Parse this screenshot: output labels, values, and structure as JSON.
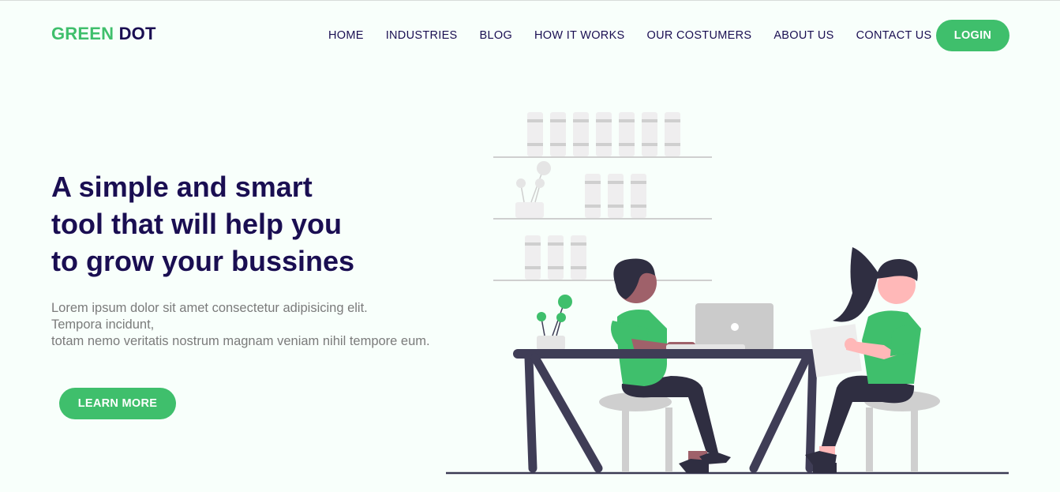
{
  "brand": {
    "part1": "GREEN",
    "part2": "DOT",
    "accent_color": "#3fbf6c",
    "dark_color": "#1a0e52"
  },
  "nav": {
    "items": [
      {
        "label": "HOME"
      },
      {
        "label": "INDUSTRIES"
      },
      {
        "label": "BLOG"
      },
      {
        "label": "HOW IT WORKS"
      },
      {
        "label": "OUR COSTUMERS"
      },
      {
        "label": "ABOUT US"
      },
      {
        "label": "CONTACT US"
      }
    ],
    "login_label": "LOGIN"
  },
  "hero": {
    "title_lines": [
      "A simple and smart",
      "tool that will help you",
      "to grow your bussines"
    ],
    "body_lines": [
      "Lorem ipsum dolor sit amet consectetur adipisicing elit.",
      "Tempora incidunt,",
      "totam nemo veritatis nostrum magnam veniam nihil tempore eum."
    ],
    "cta_label": "LEARN MORE",
    "illustration": "two-people-working-at-table-illustration"
  }
}
